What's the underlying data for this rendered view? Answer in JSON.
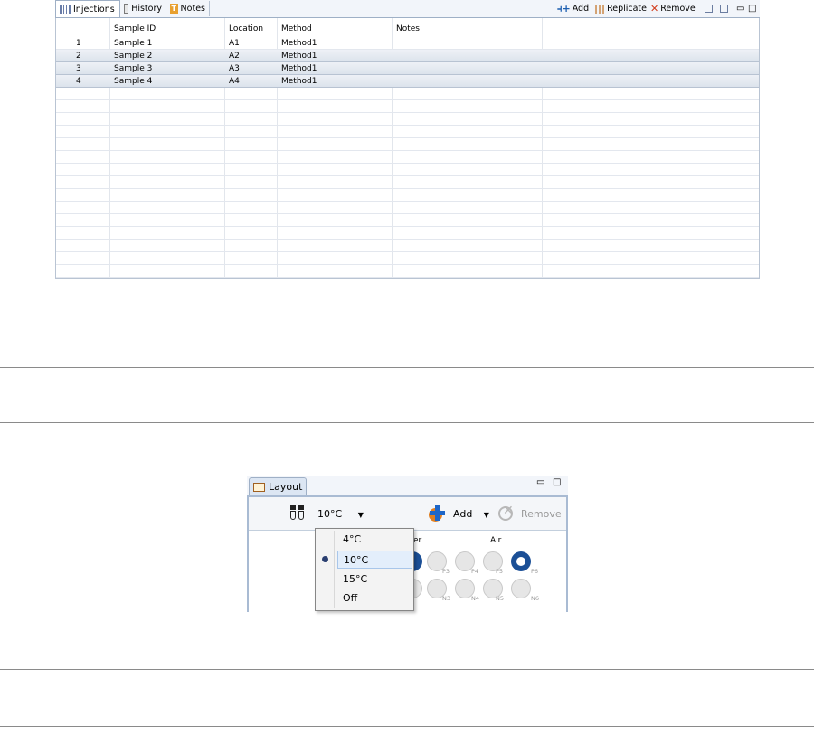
{
  "injections": {
    "tabs": [
      {
        "label": "Injections",
        "icon": "grid-icon"
      },
      {
        "label": "History",
        "icon": "history-icon"
      },
      {
        "label": "Notes",
        "icon": "notes-icon"
      }
    ],
    "toolbar": {
      "add": "Add",
      "replicate": "Replicate",
      "remove": "Remove"
    },
    "columns": [
      "Sample ID",
      "Location",
      "Method",
      "Notes"
    ],
    "rows": [
      {
        "n": "1",
        "sample": "Sample 1",
        "location": "A1",
        "method": "Method1",
        "notes": ""
      },
      {
        "n": "2",
        "sample": "Sample 2",
        "location": "A2",
        "method": "Method1",
        "notes": ""
      },
      {
        "n": "3",
        "sample": "Sample 3",
        "location": "A3",
        "method": "Method1",
        "notes": ""
      },
      {
        "n": "4",
        "sample": "Sample 4",
        "location": "A4",
        "method": "Method1",
        "notes": ""
      }
    ]
  },
  "layout": {
    "tab": "Layout",
    "temperature": "10°C",
    "add": "Add",
    "remove": "Remove",
    "partial_label": "er",
    "air_label": "Air",
    "wells_row1": [
      "P3",
      "P4",
      "P5",
      "P6"
    ],
    "wells_row2": [
      "N3",
      "N4",
      "N5",
      "N6"
    ],
    "temp_options": [
      "4°C",
      "10°C",
      "15°C",
      "Off"
    ],
    "selected_option": "10°C"
  },
  "colors": {
    "accent": "#1b4f96",
    "selection": "#dce3ec"
  }
}
